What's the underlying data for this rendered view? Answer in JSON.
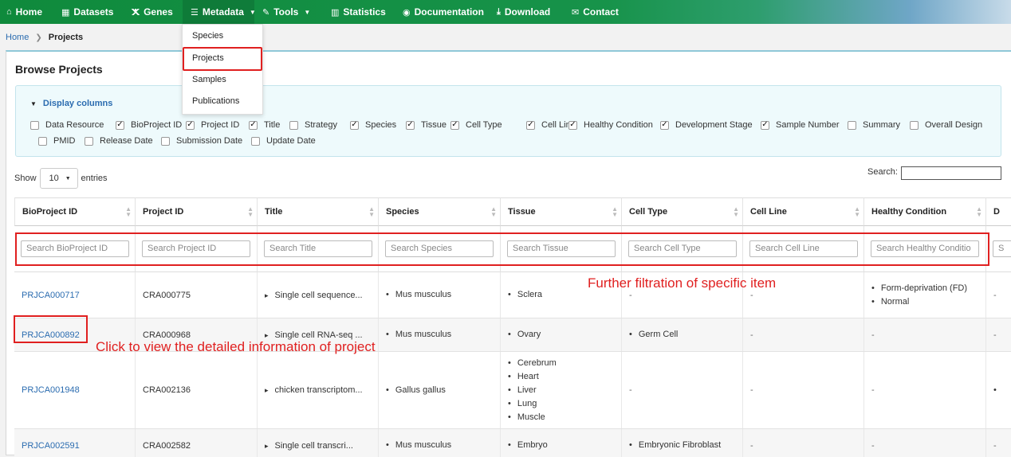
{
  "nav": {
    "items": [
      {
        "label": "Home",
        "icon": "home-icon",
        "glyph": "⌂"
      },
      {
        "label": "Datasets",
        "icon": "datasets-icon",
        "glyph": "▦"
      },
      {
        "label": "Genes",
        "icon": "genes-icon",
        "glyph": "ⵅ"
      },
      {
        "label": "Metadata",
        "icon": "metadata-icon",
        "glyph": "☰"
      },
      {
        "label": "Tools",
        "icon": "tools-icon",
        "glyph": "✎"
      },
      {
        "label": "Statistics",
        "icon": "statistics-icon",
        "glyph": "▥"
      },
      {
        "label": "Documentation",
        "icon": "documentation-icon",
        "glyph": "◉"
      },
      {
        "label": "Download",
        "icon": "download-icon",
        "glyph": "⤓"
      },
      {
        "label": "Contact",
        "icon": "contact-icon",
        "glyph": "✉"
      }
    ]
  },
  "breadcrumb": {
    "home": "Home",
    "current": "Projects"
  },
  "metadata_menu": {
    "items": [
      "Species",
      "Projects",
      "Samples",
      "Publications"
    ],
    "selected": "Projects"
  },
  "panel": {
    "title": "Browse Projects",
    "display_columns_label": "Display columns",
    "columns": [
      {
        "label": "Data Resource",
        "checked": false
      },
      {
        "label": "BioProject ID",
        "checked": true
      },
      {
        "label": "Project ID",
        "checked": true
      },
      {
        "label": "Title",
        "checked": true
      },
      {
        "label": "Strategy",
        "checked": false
      },
      {
        "label": "Species",
        "checked": true
      },
      {
        "label": "Tissue",
        "checked": true
      },
      {
        "label": "Cell Type",
        "checked": true
      },
      {
        "label": "Cell Line",
        "checked": true
      },
      {
        "label": "Healthy Condition",
        "checked": true
      },
      {
        "label": "Development Stage",
        "checked": true
      },
      {
        "label": "Sample Number",
        "checked": true
      },
      {
        "label": "Summary",
        "checked": false
      },
      {
        "label": "Overall Design",
        "checked": false
      },
      {
        "label": "PMID",
        "checked": false
      },
      {
        "label": "Release Date",
        "checked": false
      },
      {
        "label": "Submission Date",
        "checked": false
      },
      {
        "label": "Update Date",
        "checked": false
      }
    ]
  },
  "table_controls": {
    "show": "Show",
    "entries_value": "10",
    "entries": "entries",
    "search_label": "Search:"
  },
  "table": {
    "headers": [
      "BioProject ID",
      "Project ID",
      "Title",
      "Species",
      "Tissue",
      "Cell Type",
      "Cell Line",
      "Healthy Condition",
      "D"
    ],
    "filter_placeholders": [
      "Search BioProject ID",
      "Search Project ID",
      "Search Title",
      "Search Species",
      "Search Tissue",
      "Search Cell Type",
      "Search Cell Line",
      "Search Healthy Conditio",
      "S"
    ],
    "rows": [
      {
        "bioproject": "PRJCA000717",
        "project": "CRA000775",
        "title": "Single cell sequence...",
        "species": [
          "Mus musculus"
        ],
        "tissue": [
          "Sclera"
        ],
        "cell_type": "-",
        "cell_line": "-",
        "healthy": [
          "Form-deprivation (FD)",
          "Normal"
        ],
        "dev": "-"
      },
      {
        "bioproject": "PRJCA000892",
        "project": "CRA000968",
        "title": "Single cell RNA-seq ...",
        "species": [
          "Mus musculus"
        ],
        "tissue": [
          "Ovary"
        ],
        "cell_type": "Germ Cell",
        "cell_line": "-",
        "healthy": "-",
        "dev": "-"
      },
      {
        "bioproject": "PRJCA001948",
        "project": "CRA002136",
        "title": "chicken transcriptom...",
        "species": [
          "Gallus gallus"
        ],
        "tissue": [
          "Cerebrum",
          "Heart",
          "Liver",
          "Lung",
          "Muscle"
        ],
        "cell_type": "-",
        "cell_line": "-",
        "healthy": "-",
        "dev": "•"
      },
      {
        "bioproject": "PRJCA002591",
        "project": "CRA002582",
        "title": "Single cell transcri...",
        "species": [
          "Mus musculus"
        ],
        "tissue": [
          "Embryo"
        ],
        "cell_type": "Embryonic Fibroblast",
        "cell_line": "-",
        "healthy": "-",
        "dev": "-"
      }
    ]
  },
  "annotations": {
    "filter_note": "Further filtration of specific item",
    "click_note": "Click to view the detailed information of project"
  }
}
